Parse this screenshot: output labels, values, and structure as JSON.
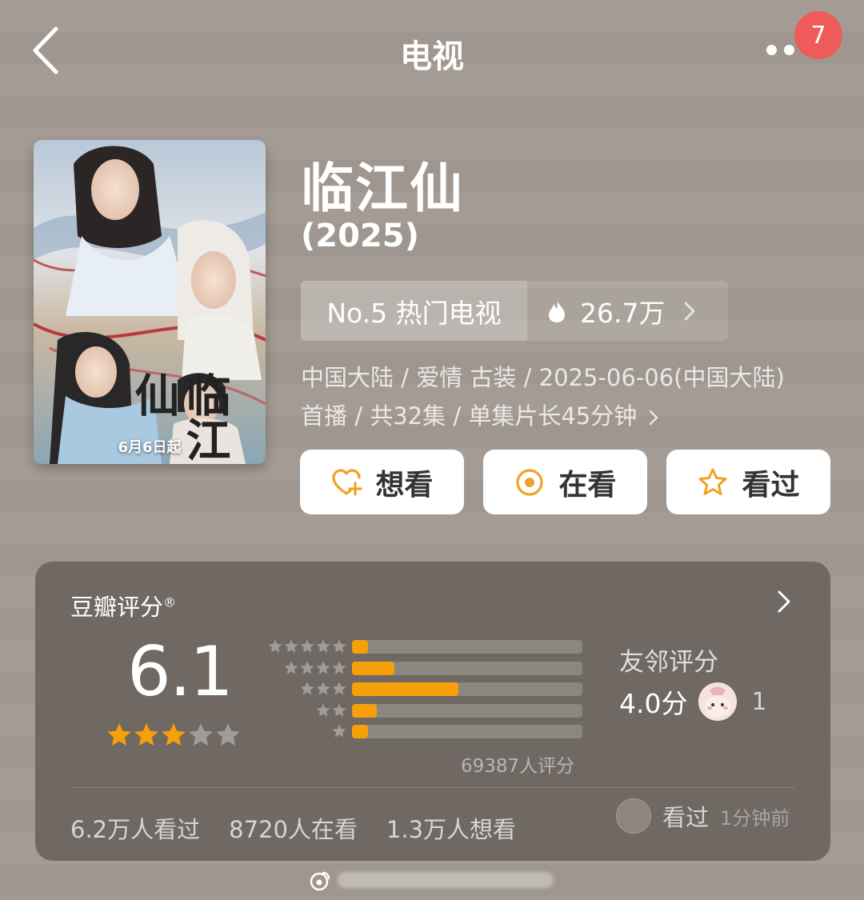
{
  "header": {
    "title": "电视",
    "notification_count": "7"
  },
  "poster": {
    "title_art": "临江仙",
    "date_text": "6月6日起"
  },
  "movie": {
    "title": "临江仙",
    "year": "(2025)",
    "rank_label": "No.5 热门电视",
    "heat_value": "26.7万",
    "meta_line1": "中国大陆 / 爱情 古装 / 2025-06-06(中国大陆)",
    "meta_line2": "首播 / 共32集 / 单集片长45分钟"
  },
  "actions": {
    "want": "想看",
    "watching": "在看",
    "watched": "看过"
  },
  "rating": {
    "title": "豆瓣评分",
    "score": "6.1",
    "star_level": 3,
    "distribution_percent": [
      2.0,
      15.4,
      38.5,
      9.0,
      2.0
    ],
    "votes": "69387人评分",
    "friends_title": "友邻评分",
    "friends_score": "4.0分",
    "friends_count": "1",
    "stats": [
      "6.2万人看过",
      "8720人在看",
      "1.3万人想看"
    ],
    "recent_action": "看过",
    "recent_time": "1分钟前"
  },
  "colors": {
    "background": "#a29a92",
    "card": "#706862",
    "accent": "#f5a00a",
    "badge": "#ef5a5a",
    "icon_orange": "#f0a224"
  }
}
